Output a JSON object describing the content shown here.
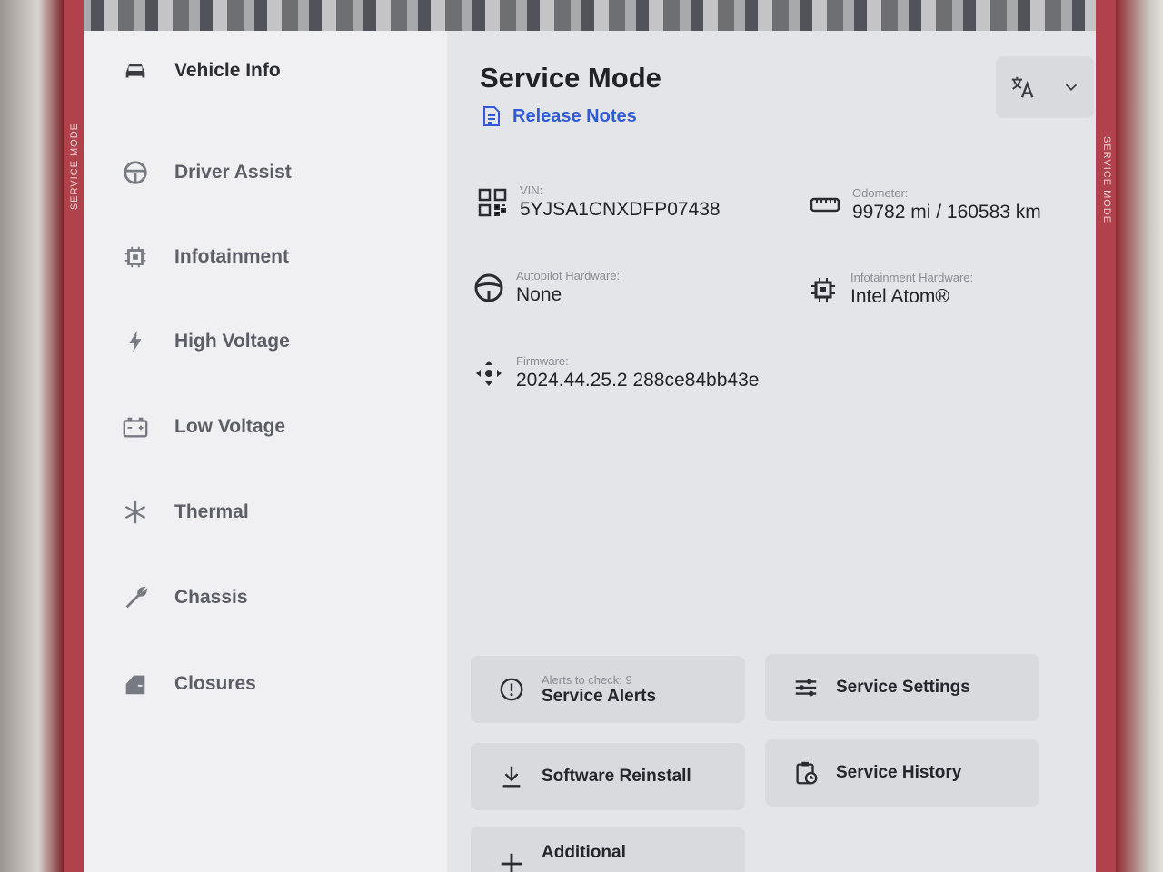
{
  "sidebar": {
    "side_label": "SERVICE MODE",
    "items": [
      {
        "label": "Vehicle Info",
        "icon": "car-icon"
      },
      {
        "label": "Driver Assist",
        "icon": "steering-wheel-icon"
      },
      {
        "label": "Infotainment",
        "icon": "chip-icon"
      },
      {
        "label": "High Voltage",
        "icon": "lightning-icon"
      },
      {
        "label": "Low Voltage",
        "icon": "battery-icon"
      },
      {
        "label": "Thermal",
        "icon": "snowflake-icon"
      },
      {
        "label": "Chassis",
        "icon": "wrench-icon"
      },
      {
        "label": "Closures",
        "icon": "door-icon"
      }
    ]
  },
  "header": {
    "title": "Service Mode",
    "release_notes": "Release Notes",
    "language_icon": "translate-icon"
  },
  "info": {
    "vin": {
      "label": "VIN:",
      "value": "5YJSA1CNXDFP07438"
    },
    "odometer": {
      "label": "Odometer:",
      "value": "99782 mi / 160583 km"
    },
    "autopilot": {
      "label": "Autopilot Hardware:",
      "value": "None"
    },
    "infotainment_hw": {
      "label": "Infotainment Hardware:",
      "value": "Intel Atom®"
    },
    "firmware": {
      "label": "Firmware:",
      "value": "2024.44.25.2 288ce84bb43e"
    }
  },
  "tiles": {
    "alerts": {
      "sub": "Alerts to check: 9",
      "label": "Service Alerts"
    },
    "settings": {
      "label": "Service Settings"
    },
    "reinstall": {
      "label": "Software Reinstall"
    },
    "history": {
      "label": "Service History"
    },
    "additional": {
      "label": "Additional"
    }
  },
  "colors": {
    "accent": "#2f5bd8",
    "service_mode_red": "#b1414a"
  }
}
